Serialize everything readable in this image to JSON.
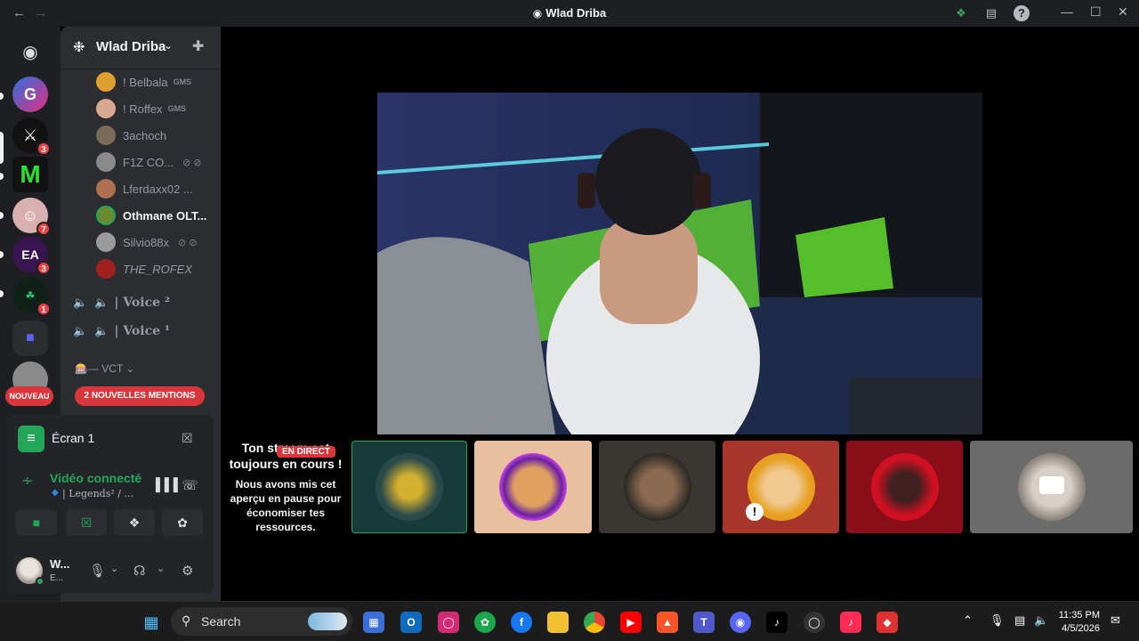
{
  "window": {
    "title": "Wlad Driba"
  },
  "server": {
    "name": "Wlad Driba"
  },
  "members": [
    {
      "name": "! Belbala",
      "tag": "GMS",
      "color": "#e0a030"
    },
    {
      "name": "! Roffex",
      "tag": "GMS",
      "color": "#d8a890"
    },
    {
      "name": "3achoch",
      "tag": "",
      "color": "#7a6a58"
    },
    {
      "name": "F1Z CO...",
      "tag": "",
      "color": "#8a8a8a"
    },
    {
      "name": "Lferdaxx02 ...",
      "tag": "",
      "color": "#b07050"
    },
    {
      "name": "Othmane OLT...",
      "tag": "",
      "color": "#6a8a30",
      "highlight": true
    },
    {
      "name": "Silvio88x",
      "tag": "",
      "color": "#9a9a9a"
    },
    {
      "name": "THE_ROFEX",
      "tag": "",
      "color": "#a02020"
    }
  ],
  "voice_channels": [
    "| Voice ²",
    "| Voice ¹"
  ],
  "category": "VCT",
  "mentions_label": "2 NOUVELLES MENTIONS",
  "new_label": "NOUVEAU",
  "guild_badges": [
    "3",
    "7",
    "3",
    "1"
  ],
  "screen": {
    "label": "Écran 1"
  },
  "voice": {
    "status": "Vidéo connecté",
    "channel": "| Legends² / ..."
  },
  "user": {
    "name": "W...",
    "status": "E..."
  },
  "stream": {
    "title": "Ton stream est toujours en cours !",
    "live_label": "EN DIRECT",
    "body": "Nous avons mis cet aperçu en pause pour économiser tes ressources."
  },
  "taskbar": {
    "search_placeholder": "Search",
    "time": "11:35 PM",
    "date": "4/5/2026"
  }
}
